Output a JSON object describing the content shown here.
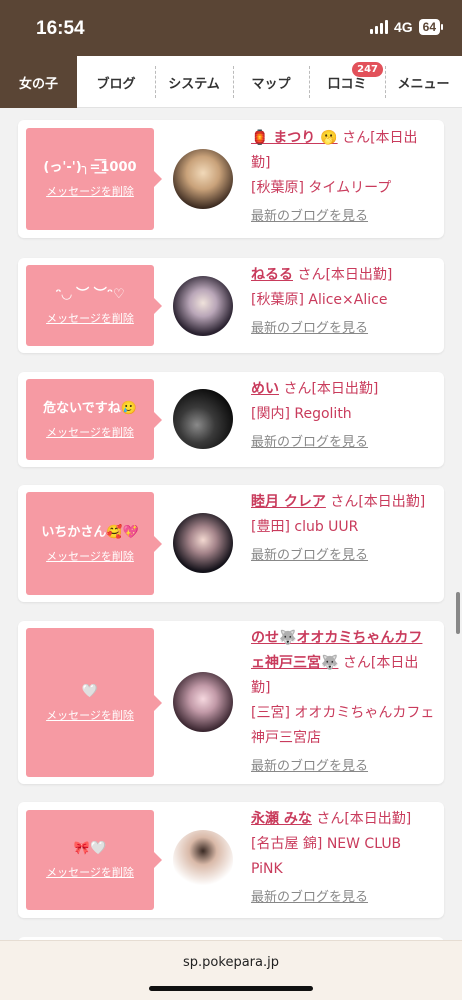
{
  "status": {
    "time": "16:54",
    "network": "4G",
    "battery": "64"
  },
  "nav": {
    "tabs": [
      {
        "label": "女の子"
      },
      {
        "label": "ブログ"
      },
      {
        "label": "システム"
      },
      {
        "label": "マップ"
      },
      {
        "label": "口コミ",
        "badge": "247"
      },
      {
        "label": "メニュー"
      }
    ]
  },
  "delete_label": "メッセージを削除",
  "blog_label": "最新のブログを見る",
  "cards": [
    {
      "message": "(っ'-')╮=͟͟͞͞1000",
      "name": "🏮 まつり 🫢",
      "san": "さん[本日出勤]",
      "shop": "[秋葉原] タイムリープ"
    },
    {
      "message": "ᵔ◡ ︶ ︶ᵔ♡",
      "name": "ねるる",
      "san": "さん[本日出勤]",
      "shop": "[秋葉原] Alice×Alice"
    },
    {
      "message": "危ないですね🥲",
      "name": "めい",
      "san": "さん[本日出勤]",
      "shop": "[関内] Regolith"
    },
    {
      "message": "いちかさん🥰💖",
      "name": "睦月 クレア",
      "san": "さん[本日出勤]",
      "shop": "[豊田] club UUR"
    },
    {
      "message": "🤍",
      "name": "のせ🐺オオカミちゃんカフェ神戸三宮🐺",
      "san": "さん[本日出勤]",
      "shop": "[三宮] オオカミちゃんカフェ神戸三宮店"
    },
    {
      "message": "🎀🤍",
      "name": "永瀬 みな",
      "san": "さん[本日出勤]",
      "shop": "[名古屋 錦] NEW CLUB PiNK"
    }
  ],
  "url": "sp.pokepara.jp",
  "colors": {
    "header_bg": "#5a4535",
    "bubble": "#f69aa3",
    "accent": "#c93b5c",
    "badge": "#e2515a"
  }
}
